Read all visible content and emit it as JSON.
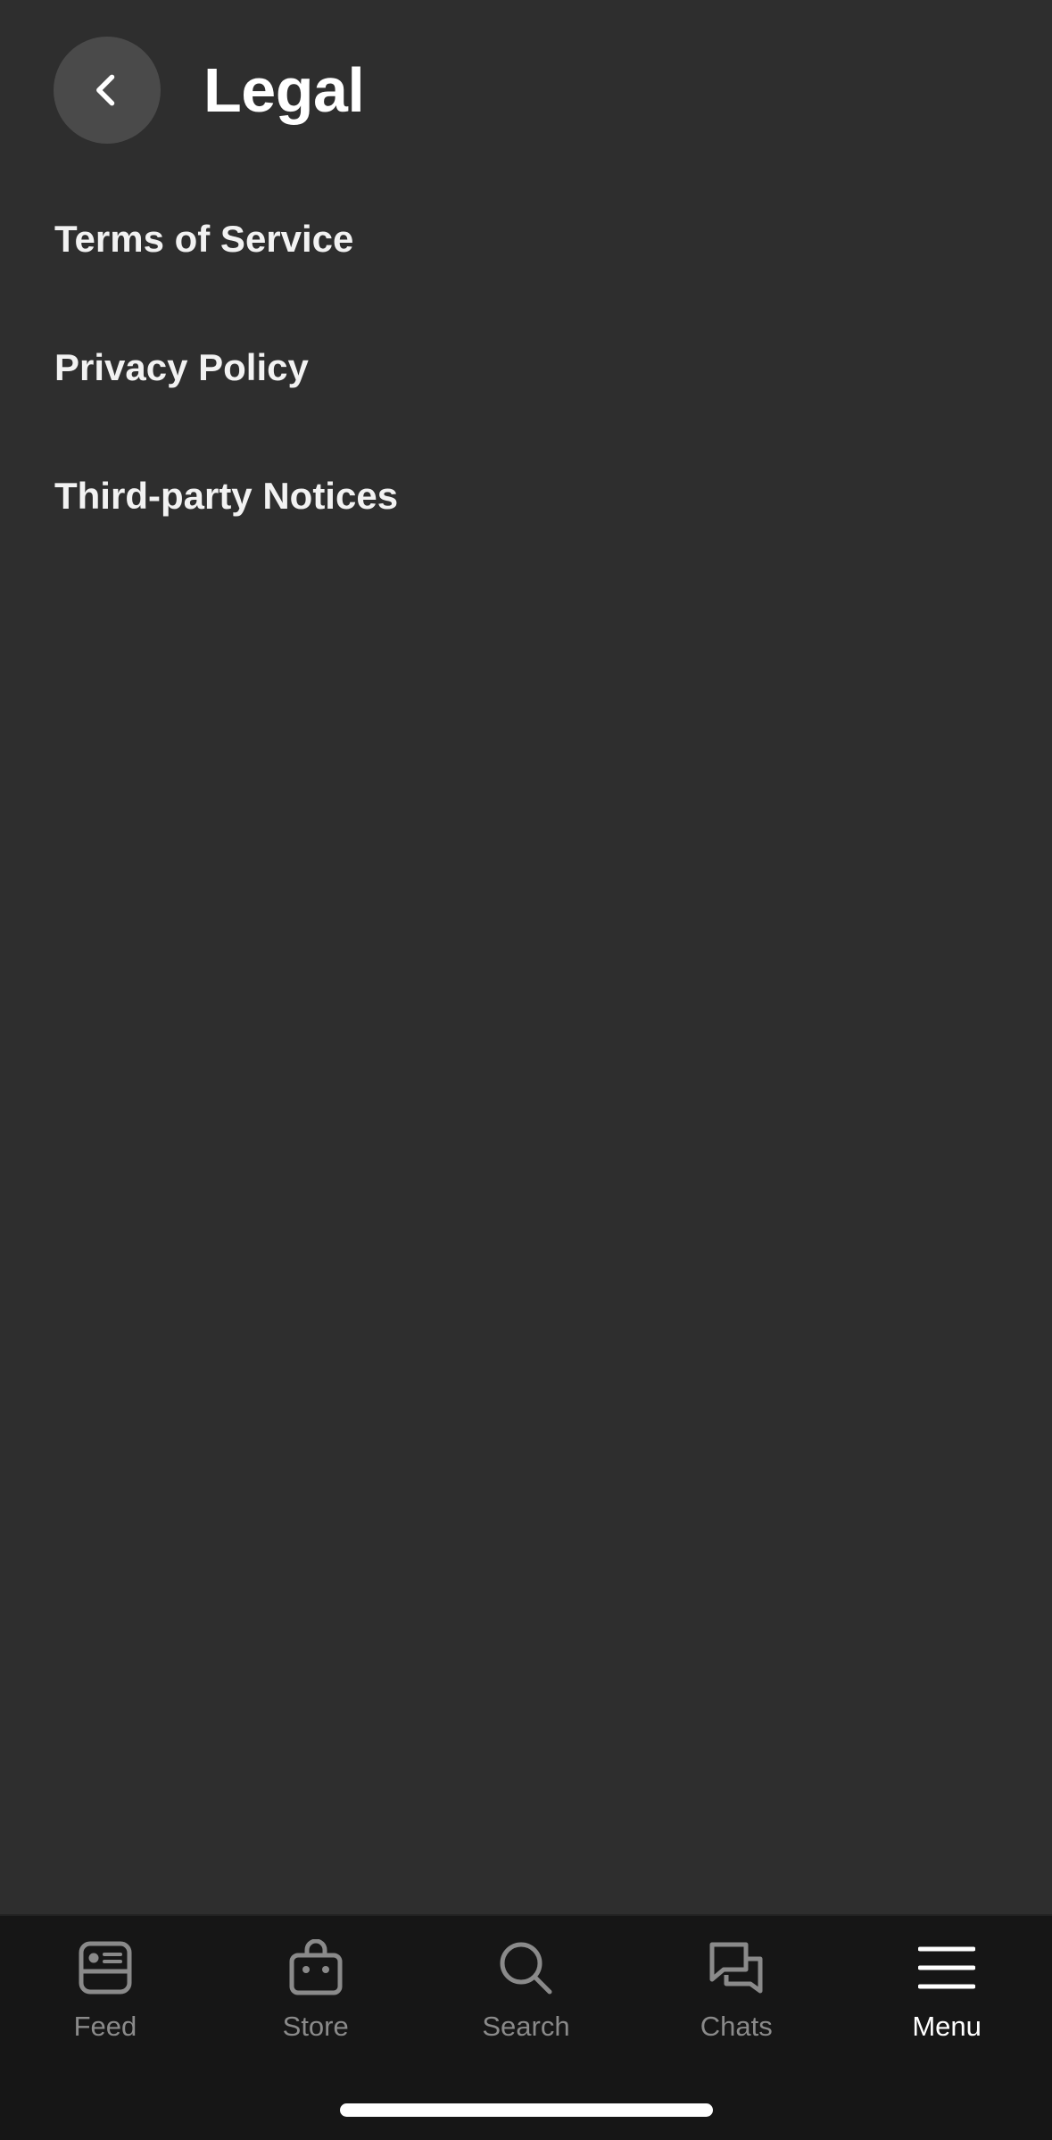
{
  "header": {
    "title": "Legal",
    "back_icon": "chevron-left-icon"
  },
  "items": [
    {
      "label": "Terms of Service"
    },
    {
      "label": "Privacy Policy"
    },
    {
      "label": "Third-party Notices"
    }
  ],
  "tabbar": {
    "tabs": [
      {
        "label": "Feed",
        "icon": "feed-icon",
        "active": false
      },
      {
        "label": "Store",
        "icon": "store-bag-icon",
        "active": false
      },
      {
        "label": "Search",
        "icon": "search-icon",
        "active": false
      },
      {
        "label": "Chats",
        "icon": "chats-icon",
        "active": false
      },
      {
        "label": "Menu",
        "icon": "menu-icon",
        "active": true
      }
    ]
  },
  "colors": {
    "background": "#2e2e2e",
    "tabbar_background": "#161616",
    "back_button": "#4a4a4a",
    "inactive_tab": "#8a8a8a",
    "active_tab": "#ffffff"
  }
}
